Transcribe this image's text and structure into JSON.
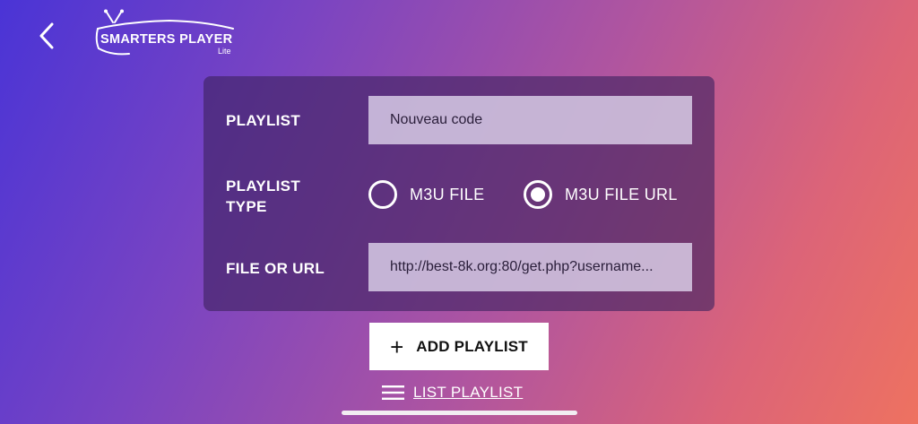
{
  "header": {
    "back_icon": "chevron-left-icon",
    "logo_title": "SMARTERS PLAYER",
    "logo_subtitle": "Lite",
    "logo_icon": "tv-icon"
  },
  "form": {
    "playlist_label": "PLAYLIST",
    "playlist_value": "Nouveau code",
    "type_label_line1": "PLAYLIST",
    "type_label_line2": "TYPE",
    "type_options": [
      {
        "label": "M3U FILE",
        "selected": false
      },
      {
        "label": "M3U FILE URL",
        "selected": true
      }
    ],
    "url_label": "FILE OR URL",
    "url_value": "http://best-8k.org:80/get.php?username..."
  },
  "actions": {
    "add_icon": "plus-icon",
    "add_label": "ADD PLAYLIST",
    "list_icon": "menu-icon",
    "list_label": "LIST PLAYLIST"
  },
  "colors": {
    "gradient_start": "#4a34d6",
    "gradient_end": "#ee7260",
    "panel": "#3e2260",
    "field": "#ded4ec"
  }
}
